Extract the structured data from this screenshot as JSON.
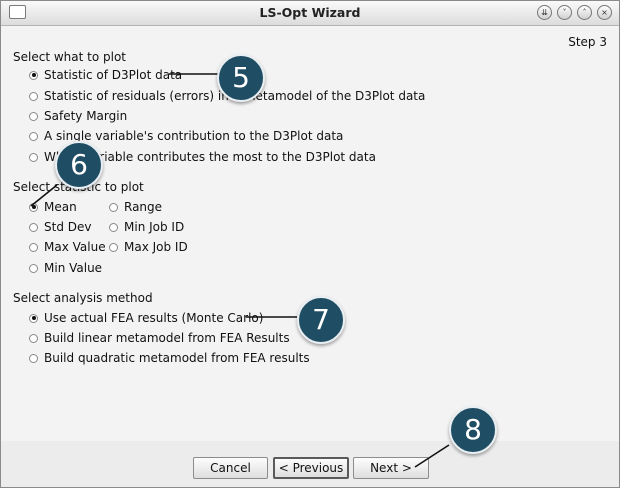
{
  "window": {
    "title": "LS-Opt Wizard",
    "step": "Step 3"
  },
  "plot": {
    "heading": "Select what to plot",
    "options": [
      "Statistic of D3Plot data",
      "Statistic of residuals (errors) in a metamodel of the D3Plot data",
      "Safety Margin",
      "A single variable's contribution to the D3Plot data",
      "Which variable contributes the most to the D3Plot data"
    ],
    "selected": 0
  },
  "statistic": {
    "heading": "Select statistic to plot",
    "options": [
      "Mean",
      "Std Dev",
      "Max Value",
      "Min Value",
      "Range",
      "Min Job ID",
      "Max Job ID"
    ],
    "selected": 0
  },
  "analysis": {
    "heading": "Select analysis method",
    "options": [
      "Use actual FEA results (Monte Carlo)",
      "Build linear metamodel from FEA Results",
      "Build quadratic metamodel from FEA results"
    ],
    "selected": 0
  },
  "buttons": {
    "cancel": "Cancel",
    "previous": "< Previous",
    "next": "Next >"
  },
  "callouts": [
    "5",
    "6",
    "7",
    "8"
  ],
  "colors": {
    "callout_fill": "#1f4d63",
    "callout_ring": "#e8eef2"
  }
}
